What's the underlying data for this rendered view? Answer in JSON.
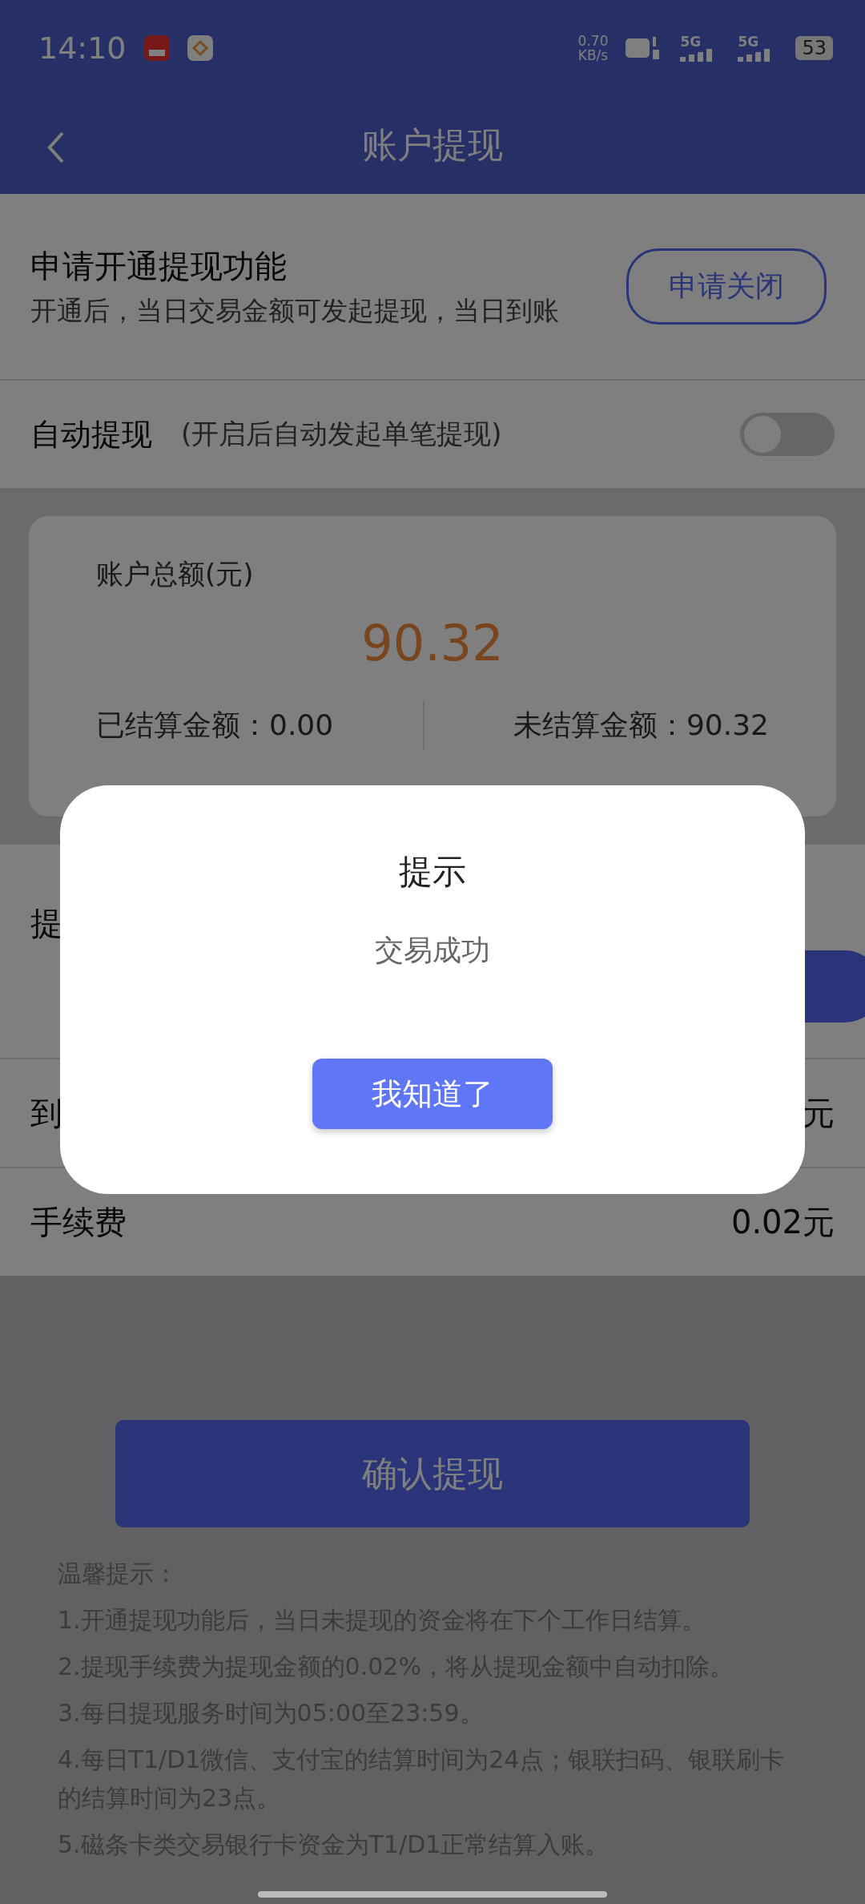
{
  "status_bar": {
    "time": "14:10",
    "net_speed": "0.70",
    "net_unit": "KB/s",
    "sim": [
      "5G",
      "5G"
    ],
    "battery": "53"
  },
  "header": {
    "title": "账户提现"
  },
  "apply": {
    "title": "申请开通提现功能",
    "description": "开通后，当日交易金额可发起提现，当日到账",
    "button": "申请关闭"
  },
  "auto_withdraw": {
    "label": "自动提现",
    "hint": "(开启后自动发起单笔提现)",
    "on": false
  },
  "balance_card": {
    "label": "账户总额(元)",
    "total": "90.32",
    "settled": "已结算金额：0.00",
    "unsettled": "未结算金额：90.32"
  },
  "withdraw_amount": {
    "label": "提"
  },
  "arrival": {
    "label": "到",
    "value": "元"
  },
  "fee": {
    "label": "手续费",
    "value": "0.02元"
  },
  "confirm_button": "确认提现",
  "tips": {
    "title": "温馨提示：",
    "items": [
      "1.开通提现功能后，当日未提现的资金将在下个工作日结算。",
      "2.提现手续费为提现金额的0.02%，将从提现金额中自动扣除。",
      "3.每日提现服务时间为05:00至23:59。",
      "4.每日T1/D1微信、支付宝的结算时间为24点；银联扫码、银联刷卡的结算时间为23点。",
      "5.磁条卡类交易银行卡资金为T1/D1正常结算入账。"
    ]
  },
  "dialog": {
    "title": "提示",
    "message": "交易成功",
    "button": "我知道了"
  }
}
